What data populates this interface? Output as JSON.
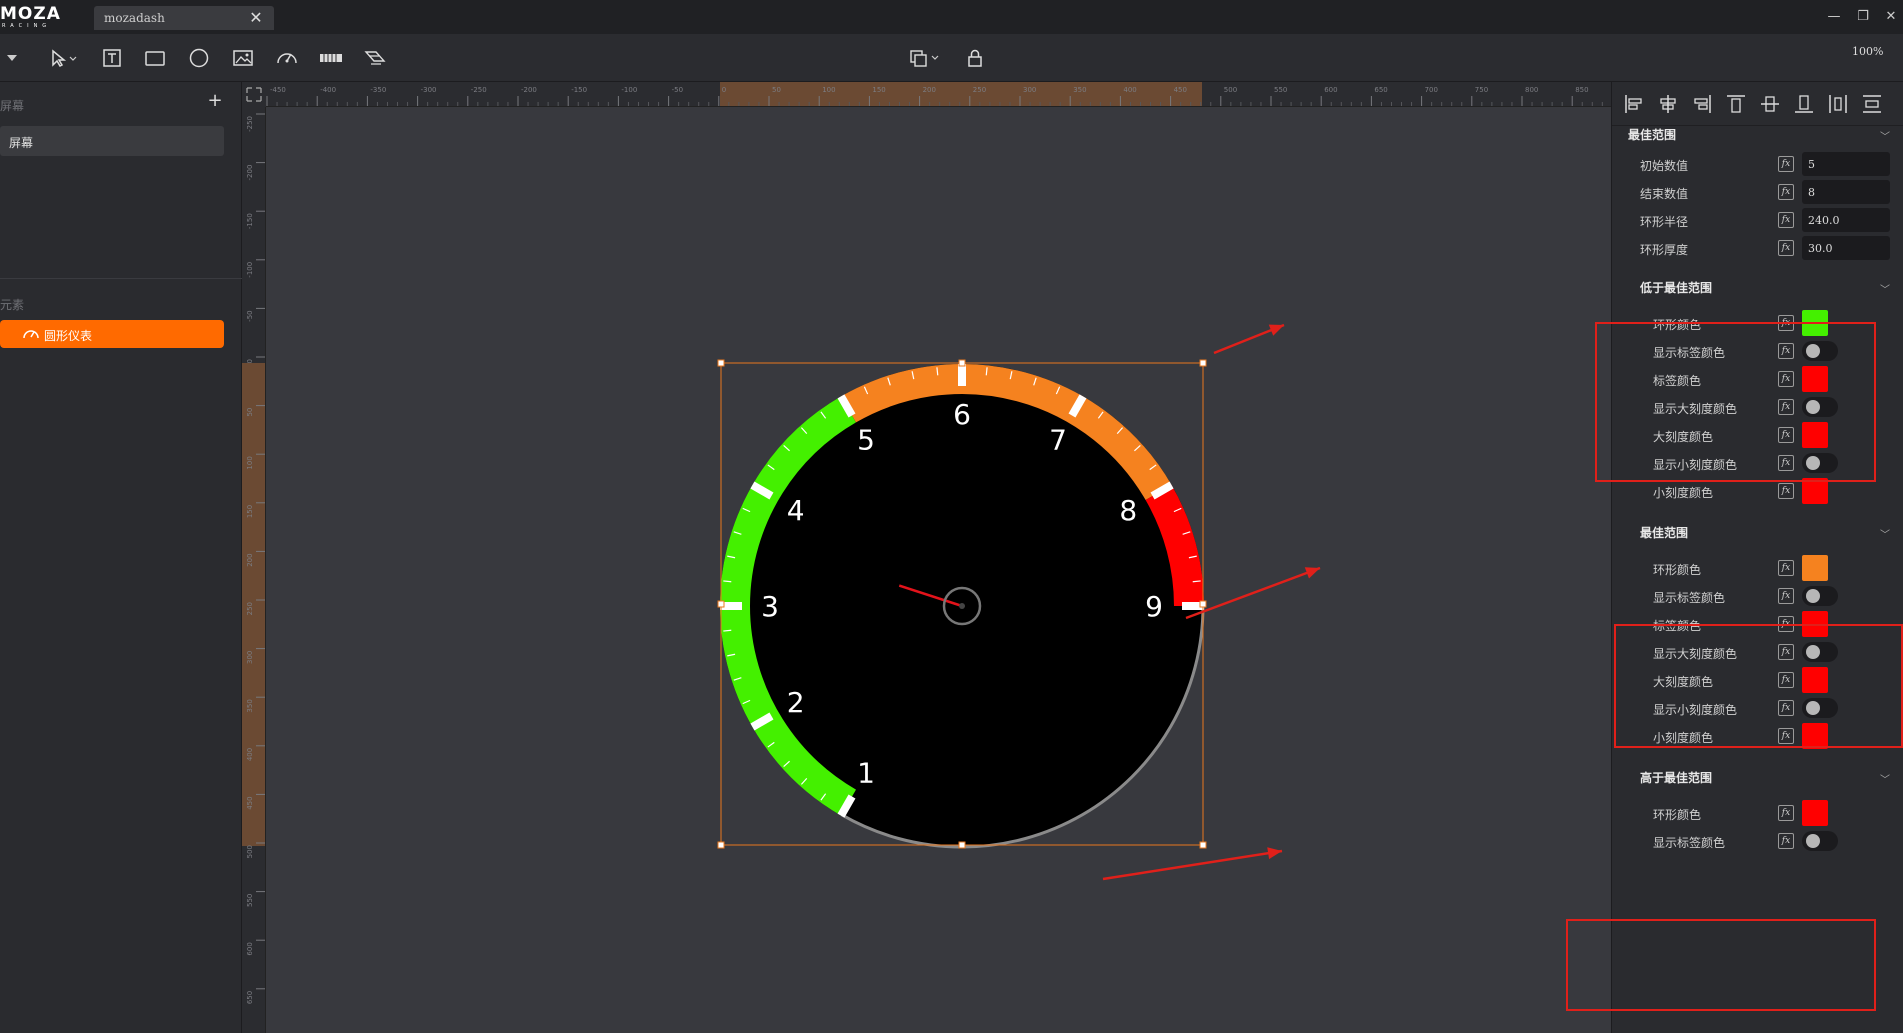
{
  "app": {
    "logo_text": "MOZA",
    "logo_sub": "RACING",
    "tab_title": "mozadash",
    "tab_close": "✕",
    "window_controls": {
      "minimize": "—",
      "restore": "❐",
      "close": "✕"
    }
  },
  "toolbar": {
    "tools": [
      "collapse-menu",
      "select-tool",
      "text-tool",
      "rectangle-tool",
      "circle-tool",
      "image-tool",
      "gauge-tool",
      "bar-tool",
      "shift-light-tool"
    ],
    "zoom": "100%"
  },
  "left_panel": {
    "screens_header": "屏幕",
    "add_label": "+",
    "screen_item": "屏幕",
    "elements_header": "元素",
    "element_item": "圆形仪表"
  },
  "rulers": {
    "top_labels": [
      "-450",
      "-400",
      "-350",
      "-300",
      "-250",
      "-200",
      "-150",
      "-100",
      "-50",
      "0",
      "50",
      "100",
      "150",
      "200",
      "250",
      "300",
      "350",
      "400",
      "450",
      "500",
      "550",
      "600",
      "650",
      "700",
      "750",
      "800",
      "850"
    ],
    "left_labels": [
      "-250",
      "-200",
      "-150",
      "-100",
      "-50",
      "0",
      "50",
      "100",
      "150",
      "200",
      "250",
      "300",
      "350",
      "400",
      "450",
      "500",
      "550",
      "600",
      "650"
    ]
  },
  "gauge": {
    "labels": [
      "1",
      "2",
      "3",
      "4",
      "5",
      "6",
      "7",
      "8",
      "9"
    ],
    "colors": {
      "below": "#44f000",
      "best": "#f5821f",
      "above": "#ff0000",
      "face": "#000000",
      "rim": "#8a8a8a",
      "needle": "#e3131b"
    },
    "best_range": [
      5,
      8
    ],
    "value": 3.6
  },
  "right_panel": {
    "sections": [
      {
        "title": "最佳范围",
        "props": [
          {
            "label": "初始数值",
            "type": "input",
            "value": "5"
          },
          {
            "label": "结束数值",
            "type": "input",
            "value": "8"
          },
          {
            "label": "环形半径",
            "type": "input",
            "value": "240.0"
          },
          {
            "label": "环形厚度",
            "type": "input",
            "value": "30.0"
          }
        ]
      },
      {
        "title": "低于最佳范围",
        "props": [
          {
            "label": "环形颜色",
            "type": "color",
            "value": "#44f000"
          },
          {
            "label": "显示标签颜色",
            "type": "toggle"
          },
          {
            "label": "标签颜色",
            "type": "color",
            "value": "#ff0000"
          },
          {
            "label": "显示大刻度颜色",
            "type": "toggle"
          },
          {
            "label": "大刻度颜色",
            "type": "color",
            "value": "#ff0000"
          },
          {
            "label": "显示小刻度颜色",
            "type": "toggle"
          },
          {
            "label": "小刻度颜色",
            "type": "color",
            "value": "#ff0000"
          }
        ]
      },
      {
        "title": "最佳范围",
        "props": [
          {
            "label": "环形颜色",
            "type": "color",
            "value": "#f5821f"
          },
          {
            "label": "显示标签颜色",
            "type": "toggle"
          },
          {
            "label": "标签颜色",
            "type": "color",
            "value": "#ff0000"
          },
          {
            "label": "显示大刻度颜色",
            "type": "toggle"
          },
          {
            "label": "大刻度颜色",
            "type": "color",
            "value": "#ff0000"
          },
          {
            "label": "显示小刻度颜色",
            "type": "toggle"
          },
          {
            "label": "小刻度颜色",
            "type": "color",
            "value": "#ff0000"
          }
        ]
      },
      {
        "title": "高于最佳范围",
        "props": [
          {
            "label": "环形颜色",
            "type": "color",
            "value": "#ff0000"
          },
          {
            "label": "显示标签颜色",
            "type": "toggle"
          }
        ]
      }
    ],
    "fx_label": "fx",
    "chevron": "﹀"
  },
  "annotation_color": "#e0201a"
}
